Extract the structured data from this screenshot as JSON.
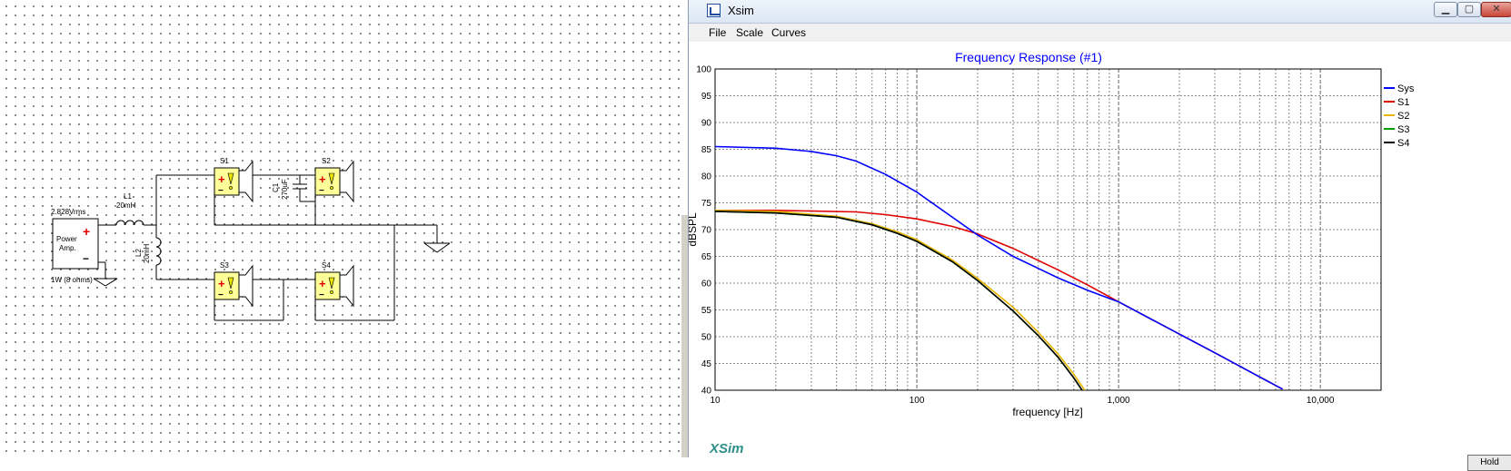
{
  "schematic": {
    "source": {
      "voltage_label": "2.828Vrms",
      "name_line1": "Power",
      "name_line2": "Amp.",
      "load_label": "1W (8 ohms)",
      "plus": "+",
      "minus": "−"
    },
    "inductor1": {
      "name": "L1",
      "value": "20mH"
    },
    "inductor2": {
      "name": "L2",
      "value": "20mH"
    },
    "capacitor1": {
      "name": "C1",
      "value": "270uF"
    },
    "speakers": [
      {
        "name": "S1"
      },
      {
        "name": "S2"
      },
      {
        "name": "S3"
      },
      {
        "name": "S4"
      }
    ]
  },
  "window": {
    "title": "Xsim",
    "menu": {
      "file": "File",
      "scale": "Scale",
      "curves": "Curves"
    },
    "logo": "XSim",
    "hold_label": "Hold",
    "controls": {
      "minimize": "▁",
      "maximize": "▢",
      "close": "✕"
    }
  },
  "chart_data": {
    "type": "line",
    "title": "Frequency Response (#1)",
    "xlabel": "frequency [Hz]",
    "ylabel": "dBSPL",
    "x_scale": "log",
    "xlim": [
      10,
      20000
    ],
    "ylim": [
      40,
      100
    ],
    "x_ticks": [
      10,
      100,
      1000,
      10000
    ],
    "x_tick_labels": [
      "10",
      "100",
      "1,000",
      "10,000"
    ],
    "y_ticks": [
      40,
      45,
      50,
      55,
      60,
      65,
      70,
      75,
      80,
      85,
      90,
      95,
      100
    ],
    "y_tick_labels": [
      "40",
      "45",
      "50",
      "55",
      "60",
      "65",
      "70",
      "75",
      "80",
      "85",
      "90",
      "95",
      "100"
    ],
    "grid": true,
    "legend_position": "right",
    "series": [
      {
        "name": "Sys",
        "color": "#0000ff",
        "x": [
          10,
          20,
          30,
          40,
          50,
          70,
          100,
          150,
          200,
          300,
          500,
          700,
          1000,
          2000,
          3000,
          5000,
          6500
        ],
        "y": [
          85.5,
          85.2,
          84.6,
          83.8,
          82.8,
          80.3,
          77.0,
          72.3,
          69.0,
          65.0,
          61.0,
          58.7,
          56.5,
          50.5,
          47.0,
          42.5,
          40.2
        ]
      },
      {
        "name": "S1",
        "color": "#e00000",
        "x": [
          10,
          20,
          50,
          70,
          100,
          150,
          200,
          300,
          500,
          700,
          1000,
          2000,
          3000,
          5000,
          6500
        ],
        "y": [
          73.6,
          73.6,
          73.3,
          72.8,
          72.0,
          70.6,
          69.2,
          66.5,
          62.5,
          59.7,
          56.5,
          50.5,
          47.0,
          42.5,
          40.2
        ]
      },
      {
        "name": "S2",
        "color": "#e8b400",
        "x": [
          10,
          20,
          40,
          60,
          80,
          100,
          150,
          200,
          300,
          400,
          500,
          600,
          680
        ],
        "y": [
          73.6,
          73.4,
          72.5,
          71.1,
          69.6,
          68.1,
          64.3,
          60.9,
          55.5,
          50.8,
          46.8,
          43.0,
          40.0
        ]
      },
      {
        "name": "S3",
        "color": "#00a000",
        "x": [
          10,
          20,
          40,
          60,
          80,
          100,
          150,
          200,
          300,
          400,
          500,
          600,
          660
        ],
        "y": [
          73.4,
          73.1,
          72.3,
          70.9,
          69.3,
          67.8,
          64.0,
          60.5,
          54.8,
          50.2,
          46.2,
          42.3,
          40.0
        ]
      },
      {
        "name": "S4",
        "color": "#000000",
        "x": [
          10,
          20,
          40,
          60,
          80,
          100,
          150,
          200,
          300,
          400,
          500,
          600,
          660
        ],
        "y": [
          73.4,
          73.1,
          72.3,
          70.9,
          69.3,
          67.8,
          64.0,
          60.5,
          54.8,
          50.2,
          46.2,
          42.3,
          40.0
        ]
      }
    ]
  }
}
